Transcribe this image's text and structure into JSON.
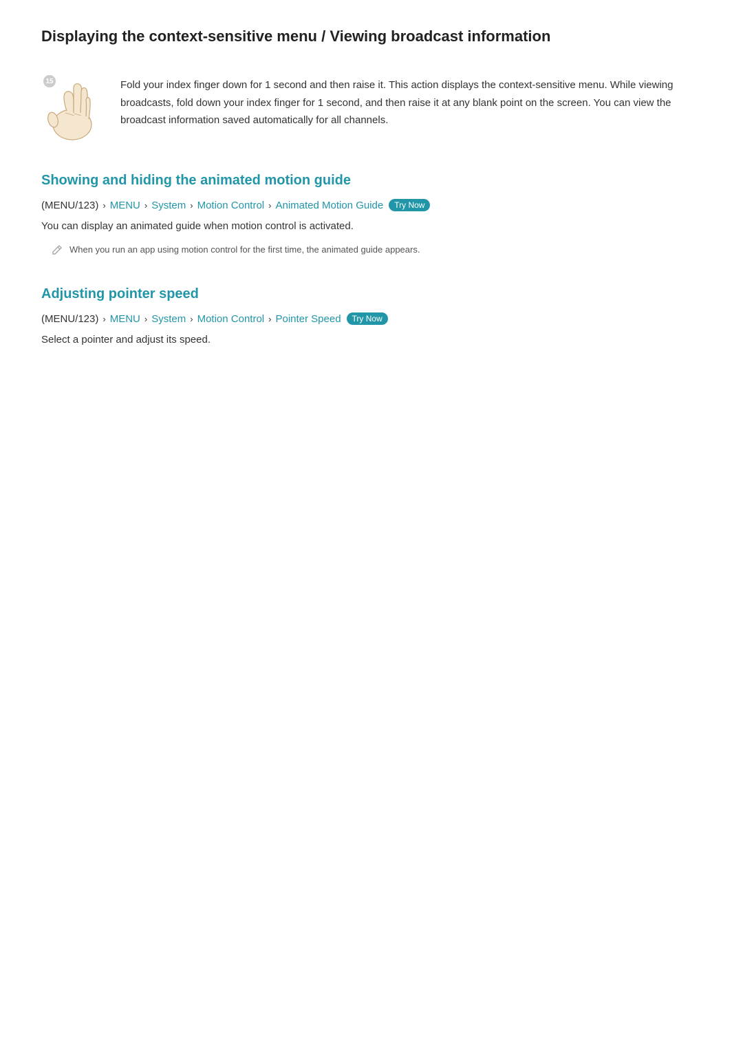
{
  "page": {
    "main_title": "Displaying the context-sensitive menu / Viewing broadcast information",
    "intro_text": "Fold your index finger down for 1 second and then raise it. This action displays the context-sensitive menu. While viewing broadcasts, fold down your index finger for 1 second, and then raise it at any blank point on the screen. You can view the broadcast information saved automatically for all channels.",
    "badge_number": "15",
    "section1": {
      "title": "Showing and hiding the animated motion guide",
      "breadcrumb": {
        "menu123": "(MENU/123)",
        "arrow1": "›",
        "menu": "MENU",
        "arrow2": "›",
        "system": "System",
        "arrow3": "›",
        "motion_control": "Motion Control",
        "arrow4": "›",
        "animated_motion_guide": "Animated Motion Guide",
        "try_now": "Try Now"
      },
      "description": "You can display an animated guide when motion control is activated.",
      "note": "When you run an app using motion control for the first time, the animated guide appears."
    },
    "section2": {
      "title": "Adjusting pointer speed",
      "breadcrumb": {
        "menu123": "(MENU/123)",
        "arrow1": "›",
        "menu": "MENU",
        "arrow2": "›",
        "system": "System",
        "arrow3": "›",
        "motion_control": "Motion Control",
        "arrow4": "›",
        "pointer_speed": "Pointer Speed",
        "try_now": "Try Now"
      },
      "description": "Select a pointer and adjust its speed."
    }
  }
}
